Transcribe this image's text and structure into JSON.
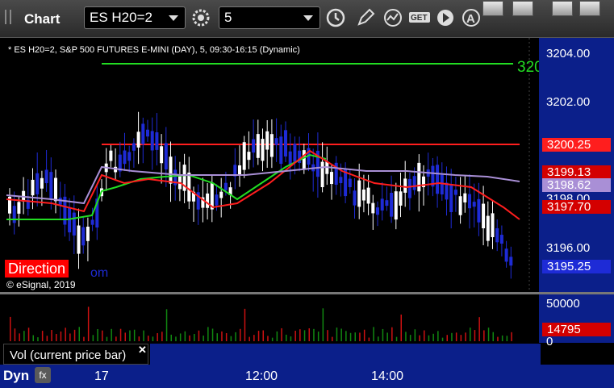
{
  "toolbar": {
    "title": "Chart",
    "symbol": "ES H20=2",
    "interval": "5"
  },
  "chart": {
    "info_line": "* ES H20=2, S&P 500 FUTURES E-MINI (DAY), 5, 09:30-16:15 (Dynamic)",
    "copyright": "© eSignal, 2019",
    "direction_label": "Direction",
    "direction_tail": "om",
    "level_line_label": "320",
    "price_ticks": [
      "3204.00",
      "3202.00",
      "3198.00",
      "3196.00"
    ],
    "price_tags": {
      "red_line": "3200.25",
      "upper": "3199.13",
      "mid": "3198.62",
      "lower": "3197.70",
      "last": "3195.25"
    },
    "volume_ticks": [
      "50000",
      "0"
    ],
    "volume_tag": "14795",
    "volume_label": "Vol (current price bar)",
    "time_ticks": [
      "17",
      "12:00",
      "14:00"
    ],
    "status_mode": "Dyn",
    "status_icon": "fx"
  },
  "colors": {
    "axis_bg": "#0b1f8a",
    "up_candle": "#ffffff",
    "down_candle": "#1e2bd6",
    "green_line": "#22dd22",
    "red_line": "#ff1e1e",
    "purple_line": "#a98fd6"
  }
}
